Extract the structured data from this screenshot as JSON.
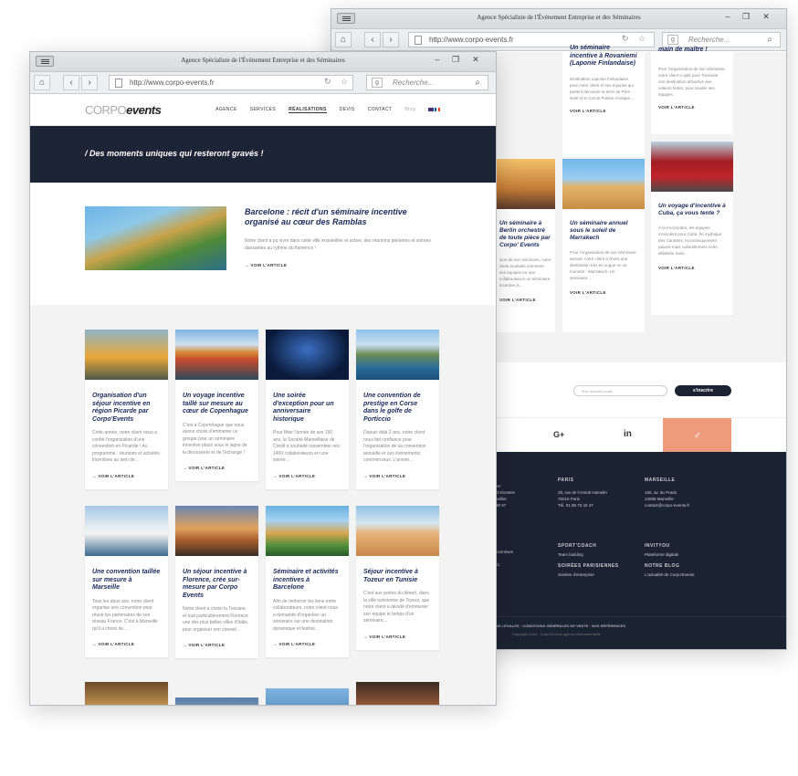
{
  "back_window": {
    "title": "Agence Spécialiste de l'Événement Entreprise et des Séminaires",
    "url": "http://www.corpo-events.fr",
    "search_placeholder": "Recherche...",
    "cards_top": [
      {
        "title": "cohésion d'équipe à",
        "partial": "incentive à Rovaniemi (Laponie Finlandaise)"
      },
      {
        "title": "main de maître !"
      }
    ],
    "col1_title": "Un séminaire incentive à Rovaniemi (Laponie Finlandaise)",
    "col1_text": "Destination Laponie Finlandaise pour notre client et ses équipes qui partent découvrir la terre du Père Noël et le Cercle Polaire Arctique…",
    "col2_text": "Pour l'organisation de son séminaire, notre client a opté pour Toulouse, une destination attractive aux valeurs fortes, pour souder ses équipes.",
    "col0_text": "compenser les performants, notre offre à ses laborateurs un séjour Ile de Madère",
    "berlin_title": "Un séminaire à Berlin orchestré de toute pièce par Corpo' Events",
    "berlin_text": "sion de son séminaire, notre client souhaite emmener ses équipes en une collaborateurs un séminaire incentive à…",
    "marrakech_title": "Un séminaire annuel sous le soleil de Marrakech",
    "marrakech_text": "Pour l'organisation de son séminaire annuel, notre client a choisi une destination très en vogue en ce moment : Marrakech. Un séminaire…",
    "cuba_title": "Un voyage d'incentive à Cuba, ça vous tente ?",
    "cuba_text": "À la mi-Octobre, les équipes s'envolent pour Cuba, île mythique des Caraïbes, économiquement pauvre mais culturellement riche, délabrée mais…",
    "read_more": "VOIR L'ARTICLE",
    "newsletter_placeholder": "Mon adresse email",
    "newsletter_button": "s'inscrire",
    "social": [
      "G+",
      "in",
      "♂"
    ],
    "offices": [
      {
        "city": "",
        "lines": [
          "Ier",
          "nt Einstein",
          "pellier",
          "30 97"
        ]
      },
      {
        "city": "PARIS",
        "lines": [
          "28, rue de l'Amiral Hamelin",
          "75016 Paris",
          "Tél. 01 85 73 42 47"
        ]
      },
      {
        "city": "MARSEILLE",
        "lines": [
          "165, av. du Prado",
          "13008 Marseille",
          "contact@corpo-events.fr"
        ]
      }
    ],
    "brands": [
      {
        "title": "",
        "lines": [
          "ncentives",
          "IC"
        ]
      },
      {
        "title": "SPORT'COACH",
        "lines": [
          "Team building"
        ]
      },
      {
        "title": "INVITYOU",
        "lines": [
          "Plateforme digitale"
        ]
      },
      {
        "title": "SOIRÉES PARISIENNES",
        "lines": [
          "Soirées d'entreprise"
        ]
      },
      {
        "title": "NOTRE BLOG",
        "lines": [
          "L'actualité de Corpo'Events"
        ]
      }
    ],
    "legal": "NS LÉGALES · CONDITIONS GÉNÉRALES DE VENTE · NOS RÉFÉRENCES",
    "copyright": "Copyright 2016 · Corpo'Events agence événementielle"
  },
  "front_window": {
    "title": "Agence Spécialiste de l'Événement Entreprise et des Séminaires",
    "url": "http://www.corpo-events.fr",
    "search_placeholder": "Recherche...",
    "logo_a": "CORPO",
    "logo_b": "events",
    "nav": [
      "AGENCE",
      "SERVICES",
      "RÉALISATIONS",
      "DEVIS",
      "CONTACT"
    ],
    "blog": "Blog",
    "hero_tagline": "/ Des moments uniques qui resteront gravés !",
    "featured": {
      "title": "Barcelone : récit d'un séminaire incentive organisé au cœur des Ramblas",
      "text": "Notre client a pu vivre dans cette ville ensoleillée et active, des réunions plénières et soirées dansantes au rythme du flamenco !",
      "more": "VOIR L'ARTICLE"
    },
    "cards": [
      {
        "title": "Organisation d'un séjour incentive en région Picarde par Corpo'Events",
        "text": "Cette année, notre client nous a confié l'organisation d'une convention en Picardie ! Au programme : réunions et activités incentives au sein de…"
      },
      {
        "title": "Un voyage incentive taillé sur mesure au cœur de Copenhague",
        "text": "C'est à Copenhague que nous avons choisi d'emmener ce groupe pour un séminaire incentive placé sous le signe de la découverte et de l'échange !"
      },
      {
        "title": "Une soirée d'exception pour un anniversaire historique",
        "text": "Pour fêter l'année de ses 150 ans, la Société Marseillaise de Crédit a souhaité rassembler ses 1400 collaborateurs en une soirée…"
      },
      {
        "title": "Une convention de prestige en Corse dans le golfe de Porticcio",
        "text": "Depuis déjà 2 ans, notre client nous fait confiance pour l'organisation de sa convention annuelle et ces événements commerciaux. L'année…"
      },
      {
        "title": "Une convention taillée sur mesure à Marseille",
        "text": "Tous les deux ans, notre client organise une convention pour réunir les partenaires de son réseau France. C'est à Marseille qu'il a choisi de…"
      },
      {
        "title": "Un séjour incentive à Florence, crée sur-mesure par Corpo Events",
        "text": "Notre client a choisi la Toscane, et tout particulièrement Florence une des plus belles villes d'Italie, pour organiser son conseil…"
      },
      {
        "title": "Séminaire et activités incentives à Barcelone",
        "text": "Afin de renforcer les liens entre collaborateurs, notre client nous a demandé d'organiser un séminaire sur une destination dynamique et festive…"
      },
      {
        "title": "Séjour incentive à Tozeur en Tunisie",
        "text": "C'est aux portes du désert, dans la ville tunisienne de Tozeur, que notre client a décidé d'emmener son équipe le temps d'un séminaire…"
      }
    ],
    "read_more": "VOIR L'ARTICLE"
  }
}
